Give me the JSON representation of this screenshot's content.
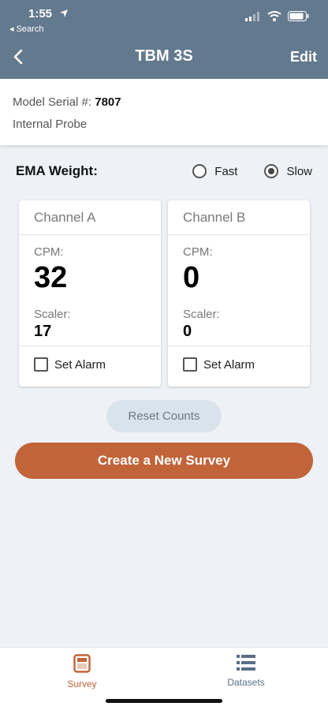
{
  "status_bar": {
    "time": "1:55",
    "back_label": "◂ Search"
  },
  "nav": {
    "back_icon": "chevron-left-icon",
    "title": "TBM 3S",
    "edit_label": "Edit"
  },
  "info": {
    "serial_label": "Model Serial #:",
    "serial_value": "7807",
    "probe": "Internal Probe"
  },
  "ema": {
    "label": "EMA Weight:",
    "options": [
      {
        "label": "Fast",
        "selected": false
      },
      {
        "label": "Slow",
        "selected": true
      }
    ]
  },
  "channels": [
    {
      "name": "Channel A",
      "cpm_label": "CPM:",
      "cpm": "32",
      "scaler_label": "Scaler:",
      "scaler": "17",
      "alarm_label": "Set Alarm"
    },
    {
      "name": "Channel B",
      "cpm_label": "CPM:",
      "cpm": "0",
      "scaler_label": "Scaler:",
      "scaler": "0",
      "alarm_label": "Set Alarm"
    }
  ],
  "buttons": {
    "reset": "Reset Counts",
    "create_survey": "Create a New Survey"
  },
  "tabs": [
    {
      "label": "Survey",
      "icon": "survey-icon",
      "active": true
    },
    {
      "label": "Datasets",
      "icon": "list-icon",
      "active": false
    }
  ],
  "colors": {
    "header": "#637a8e",
    "accent": "#c2643a",
    "reset_bg": "#d9e3ec",
    "page_bg": "#eef1f5"
  }
}
